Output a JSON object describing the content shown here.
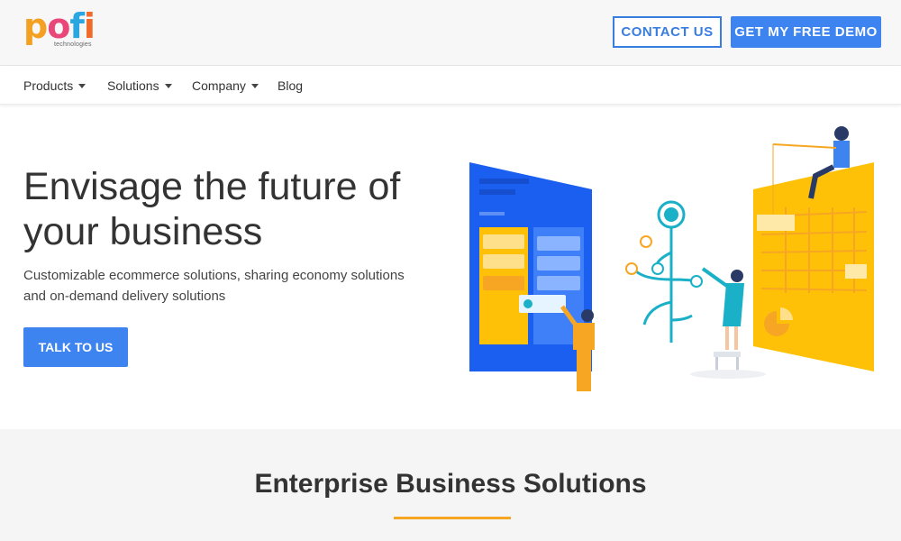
{
  "header": {
    "logo_text": "pofi",
    "logo_subtext": "technologies",
    "contact_label": "CONTACT US",
    "demo_label": "GET MY FREE DEMO"
  },
  "nav": {
    "items": [
      {
        "label": "Products",
        "has_dropdown": true
      },
      {
        "label": "Solutions",
        "has_dropdown": true
      },
      {
        "label": "Company",
        "has_dropdown": true
      },
      {
        "label": "Blog",
        "has_dropdown": false
      }
    ]
  },
  "hero": {
    "title": "Envisage the future of your business",
    "subtitle": "Customizable ecommerce solutions, sharing economy solutions and on-demand delivery solutions",
    "cta_label": "TALK TO US"
  },
  "section": {
    "title": "Enterprise Business Solutions",
    "accent_color": "#f5a623"
  },
  "colors": {
    "primary_blue": "#3d84f0",
    "illustration_blue": "#1b5ff0",
    "illustration_yellow": "#ffc107",
    "illustration_orange": "#f7a623",
    "illustration_teal": "#1ab0c8"
  }
}
